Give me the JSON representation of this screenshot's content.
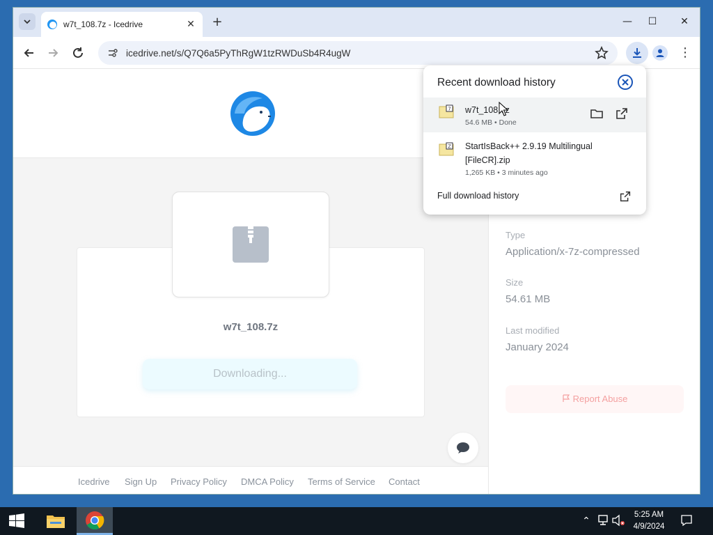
{
  "browser": {
    "tab": {
      "title": "w7t_108.7z - Icedrive"
    },
    "url": "icedrive.net/s/Q7Q6a5PyThRgW1tzRWDuSb4R4ugW",
    "window_controls": {
      "minimize": "—",
      "maximize": "☐",
      "close": "✕"
    }
  },
  "page": {
    "file_name": "w7t_108.7z",
    "download_status": "Downloading...",
    "footer_links": [
      "Icedrive",
      "Sign Up",
      "Privacy Policy",
      "DMCA Policy",
      "Terms of Service",
      "Contact"
    ],
    "details": {
      "type_label": "Type",
      "type_value": "Application/x-7z-compressed",
      "size_label": "Size",
      "size_value": "54.61 MB",
      "modified_label": "Last modified",
      "modified_value": "January 2024"
    },
    "report_label": "Report Abuse"
  },
  "download_popup": {
    "title": "Recent download history",
    "items": [
      {
        "name": "w7t_108.7z",
        "meta": "54.6 MB • Done"
      },
      {
        "name_line1": "StartIsBack++ 2.9.19 Multilingual",
        "name_line2": "[FileCR].zip",
        "meta": "1,265 KB • 3 minutes ago"
      }
    ],
    "full_history": "Full download history"
  },
  "taskbar": {
    "time": "5:25 AM",
    "date": "4/9/2024"
  },
  "colors": {
    "accent": "#1a73e8",
    "icedrive_blue": "#1e88e5",
    "report_red": "#f4a0a0"
  }
}
